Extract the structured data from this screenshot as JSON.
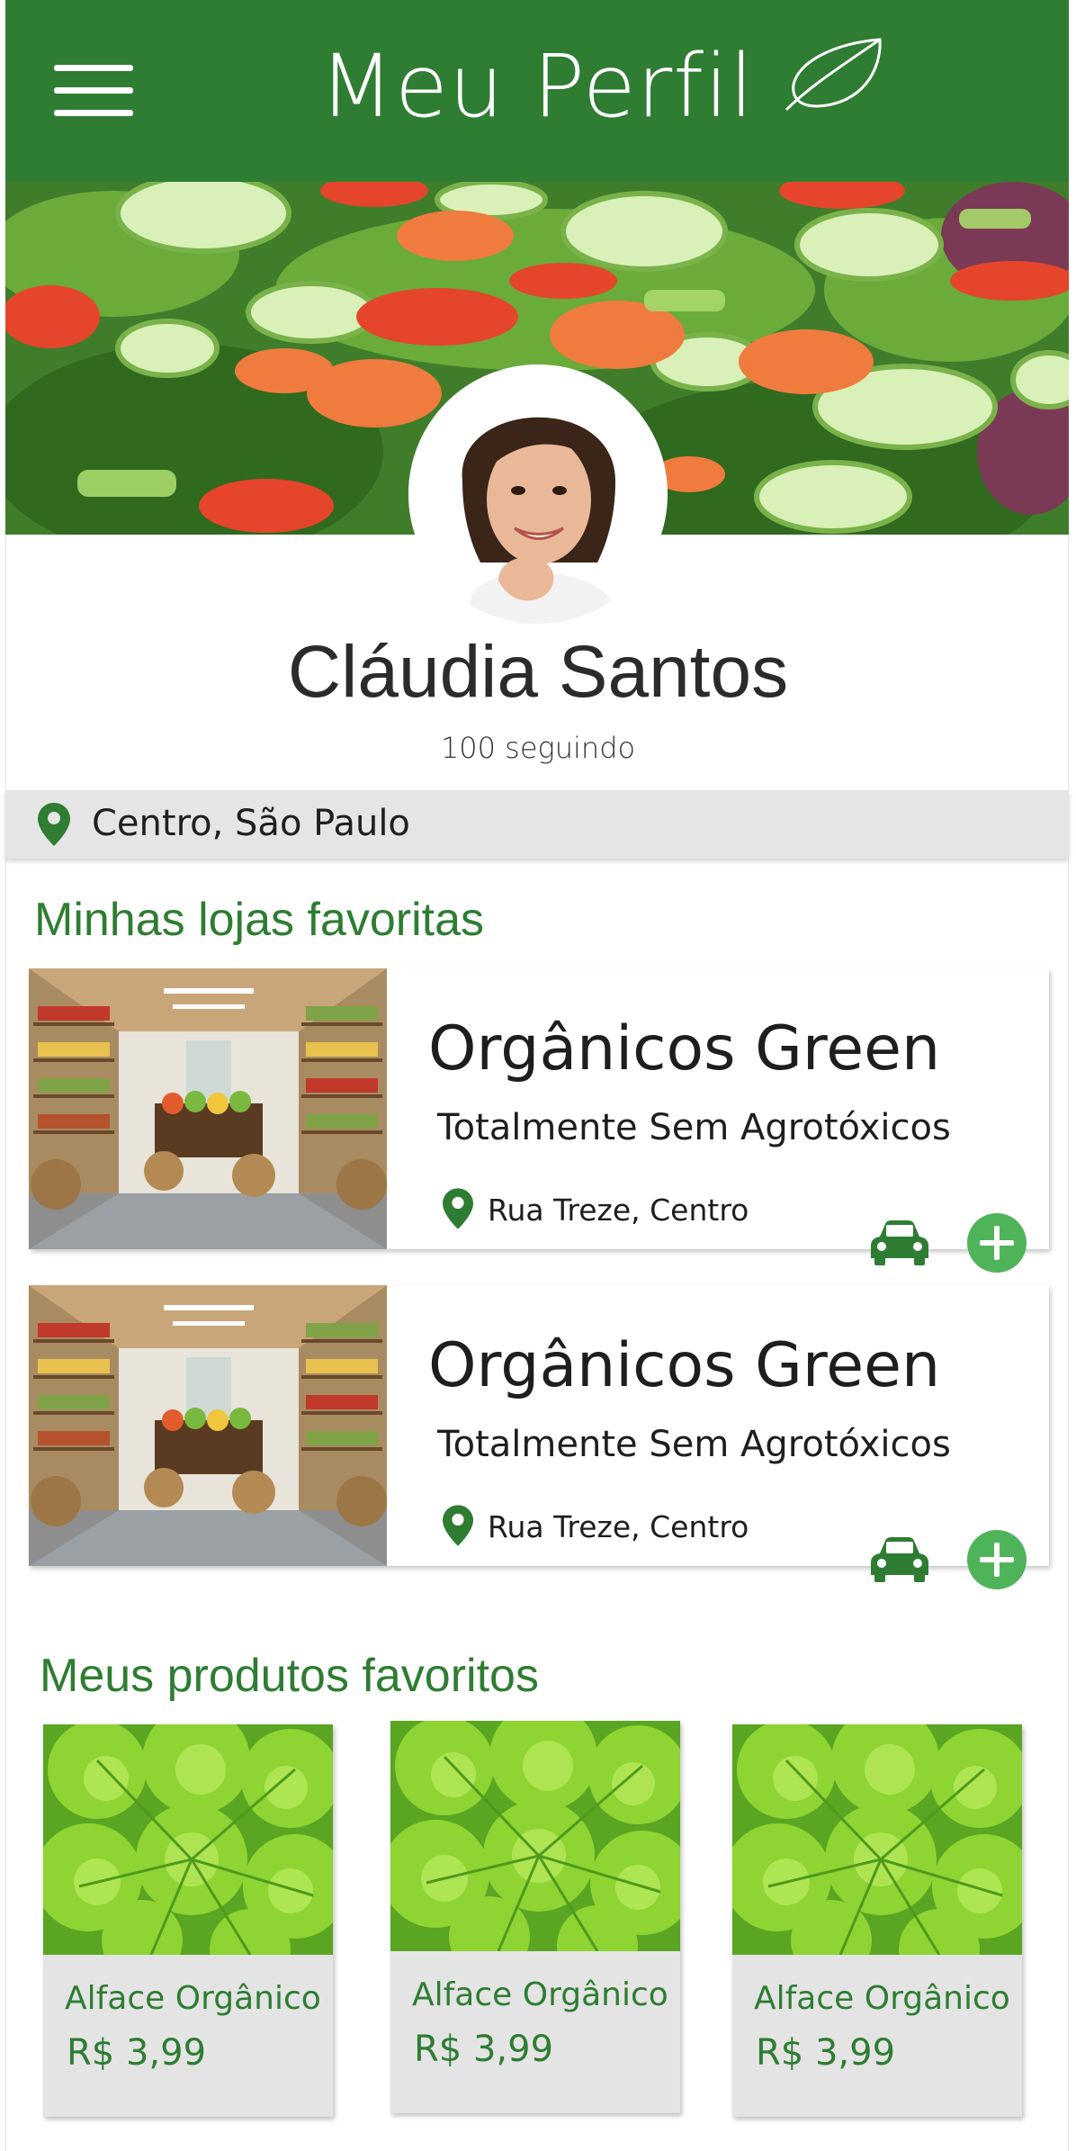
{
  "header": {
    "title": "Meu Perfil",
    "menu_icon": "hamburger-menu-icon",
    "logo_icon": "leaf-icon",
    "background": "#2e7d32"
  },
  "profile": {
    "name": "Cláudia Santos",
    "following": "100 seguindo",
    "location": "Centro, São Paulo"
  },
  "stores_section": {
    "title": "Minhas lojas favoritas",
    "items": [
      {
        "name": "Orgânicos Green",
        "description": "Totalmente Sem Agrotóxicos",
        "address": "Rua Treze, Centro"
      },
      {
        "name": "Orgânicos Green",
        "description": "Totalmente Sem Agrotóxicos",
        "address": "Rua Treze, Centro"
      }
    ]
  },
  "products_section": {
    "title": "Meus produtos favoritos",
    "items": [
      {
        "name": "Alface Orgânico",
        "price": "R$ 3,99"
      },
      {
        "name": "Alface Orgânico",
        "price": "R$ 3,99"
      },
      {
        "name": "Alface Orgânico",
        "price": "R$ 3,99"
      }
    ]
  },
  "colors": {
    "accent": "#2e7d32",
    "add_button": "#4fb35a",
    "location_bar": "#e5e5e5"
  }
}
